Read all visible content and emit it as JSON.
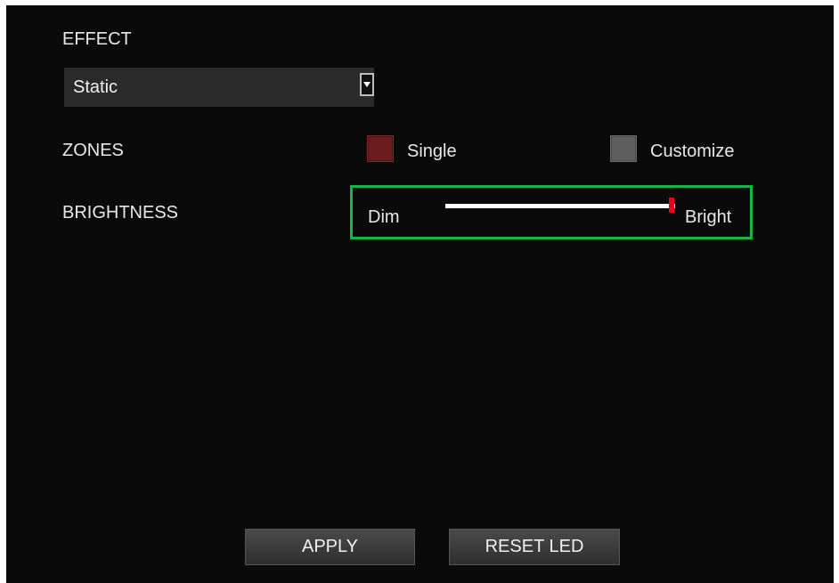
{
  "effect": {
    "label": "EFFECT",
    "selected_value": "Static",
    "dropdown_icon": "chevron-down-icon"
  },
  "zones": {
    "label": "ZONES",
    "options": [
      {
        "label": "Single",
        "selected": true,
        "color": "#6b1c1c"
      },
      {
        "label": "Customize",
        "selected": false,
        "color": "#5e5e5e"
      }
    ]
  },
  "brightness": {
    "label": "BRIGHTNESS",
    "min_label": "Dim",
    "max_label": "Bright",
    "value_fraction": 1.0,
    "highlight_color": "#12b548",
    "thumb_color": "#e6001a"
  },
  "buttons": {
    "apply_label": "APPLY",
    "reset_label": "RESET LED"
  }
}
